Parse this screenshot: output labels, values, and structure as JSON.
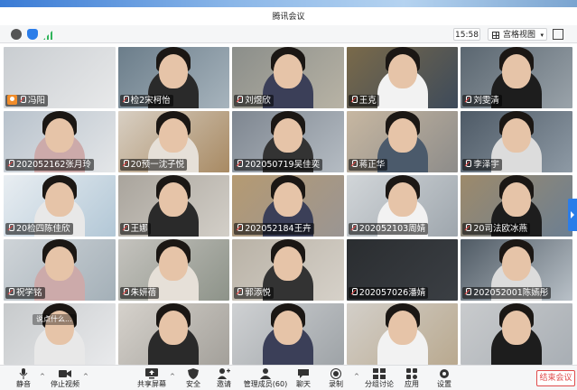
{
  "app": {
    "title": "腾讯会议",
    "time": "15:58",
    "view_mode": "宫格视图"
  },
  "colors": {
    "accent": "#2b7de9",
    "danger": "#e04b4b",
    "host": "#f08c2a"
  },
  "icons": {
    "info": "info-icon",
    "security": "shield-icon",
    "signal": "signal-icon",
    "grid": "grid-icon",
    "fullscreen": "fullscreen-icon"
  },
  "participants": [
    {
      "name": "冯阳",
      "host": true
    },
    {
      "name": "检2宋柯怡"
    },
    {
      "name": "刘煜欣"
    },
    {
      "name": "王克"
    },
    {
      "name": "刘雯清"
    },
    {
      "name": "2020521​62张月玲"
    },
    {
      "name": "20预一沈子悦"
    },
    {
      "name": "2020507​19吴佳奕"
    },
    {
      "name": "蒋正华"
    },
    {
      "name": "李泽宇"
    },
    {
      "name": "20检四陈佳欣"
    },
    {
      "name": "王娜"
    },
    {
      "name": "2020521​84王卉"
    },
    {
      "name": "2020521​03周婧"
    },
    {
      "name": "20司法欧冰燕"
    },
    {
      "name": "祝学铭"
    },
    {
      "name": "朱妍蓓"
    },
    {
      "name": "郭添悦"
    },
    {
      "name": "2020570​26潘婧"
    },
    {
      "name": "2020520​01陈嫣彤"
    },
    {
      "name": ""
    },
    {
      "name": ""
    },
    {
      "name": ""
    },
    {
      "name": ""
    },
    {
      "name": ""
    }
  ],
  "chat_overlay": "说点什么...",
  "bottom_bar": {
    "mute": "静音",
    "stop_video": "停止视频",
    "share_screen": "共享屏幕",
    "security": "安全",
    "invite": "邀请",
    "manage_members": "管理成员(60)",
    "chat": "聊天",
    "record": "录制",
    "breakout": "分组讨论",
    "apps": "应用",
    "settings": "设置",
    "end_meeting": "结束会议"
  }
}
